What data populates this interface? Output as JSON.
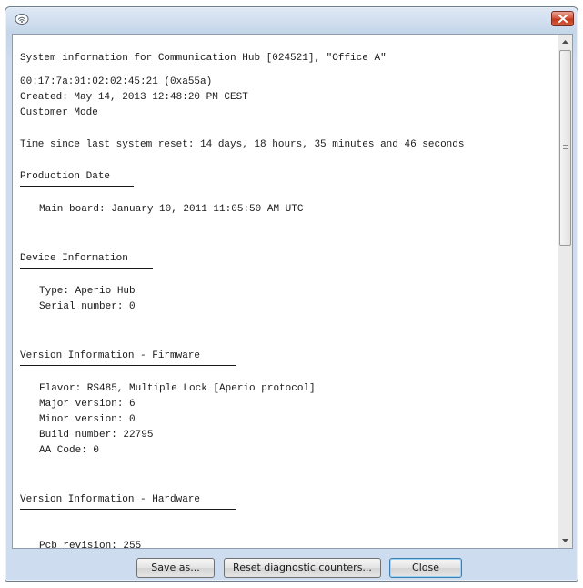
{
  "window": {
    "app_icon": "hub-icon",
    "close_icon": "close-x-icon"
  },
  "report": {
    "header_line": "System information for Communication Hub [024521], \"Office A\"",
    "mac_line": "00:17:7a:01:02:02:45:21 (0xa55a)",
    "created_line": "Created: May 14, 2013 12:48:20 PM CEST",
    "mode_line": "Customer Mode",
    "uptime_line": "Time since last system reset: 14 days, 18 hours, 35 minutes and 46 seconds",
    "production": {
      "title": "Production Date",
      "main_board": "Main board: January 10, 2011 11:05:50 AM UTC"
    },
    "device": {
      "title": "Device Information",
      "type": "Type: Aperio Hub",
      "serial": "Serial number: 0"
    },
    "firmware": {
      "title": "Version Information - Firmware",
      "flavor": "Flavor: RS485, Multiple Lock [Aperio protocol]",
      "major": "Major version: 6",
      "minor": "Minor version: 0",
      "build": "Build number: 22795",
      "aa_code": "AA Code: 0"
    },
    "hardware": {
      "title": "Version Information - Hardware",
      "partial_line": "Pcb revision: 255"
    }
  },
  "buttons": {
    "save_as": "Save as...",
    "reset_counters": "Reset diagnostic counters...",
    "close": "Close"
  }
}
